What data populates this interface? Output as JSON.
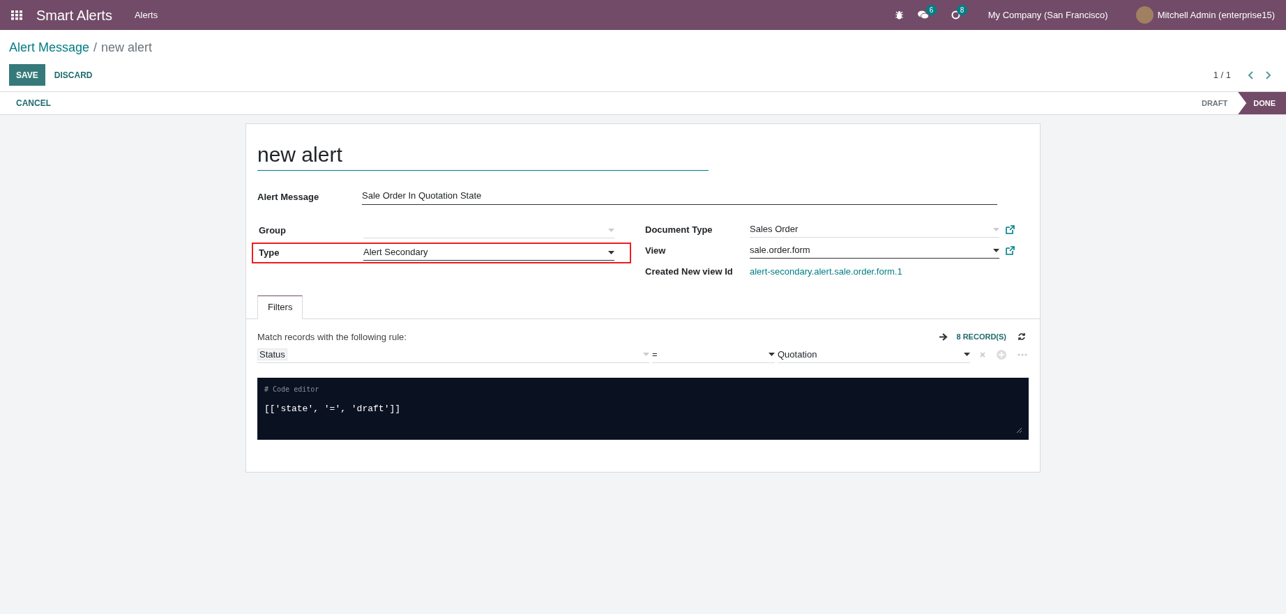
{
  "navbar": {
    "app_name": "Smart Alerts",
    "menu": [
      "Alerts"
    ],
    "messages_count": "6",
    "activities_count": "8",
    "company": "My Company (San Francisco)",
    "user": "Mitchell Admin (enterprise15)"
  },
  "breadcrumb": {
    "parent": "Alert Message",
    "separator": "/",
    "current": "new alert"
  },
  "actions": [
    {
      "label": "SAVE",
      "kind": "primary"
    },
    {
      "label": "DISCARD",
      "kind": "link"
    }
  ],
  "pager": "1 / 1",
  "header_buttons": [
    "CANCEL"
  ],
  "stages": [
    {
      "label": "DRAFT",
      "selected": false
    },
    {
      "label": "DONE",
      "selected": true
    }
  ],
  "form": {
    "title": "new alert",
    "alert_message": {
      "label": "Alert Message",
      "value": "Sale Order In Quotation State"
    },
    "left_fields": [
      {
        "label": "Group",
        "kind": "select",
        "strong": false,
        "highlighted": false
      },
      {
        "label": "Type",
        "kind": "select",
        "value": "Alert Secondary",
        "strong": true,
        "highlighted": true
      }
    ],
    "right_fields": [
      {
        "label": "Document Type",
        "kind": "select",
        "value": "Sales Order",
        "strong": false,
        "external_link": true
      },
      {
        "label": "View",
        "kind": "select",
        "value": "sale.order.form",
        "strong": true,
        "external_link": true
      },
      {
        "label": "Created New view Id",
        "kind": "link",
        "value": "alert-secondary.alert.sale.order.form.1",
        "external_link": false
      }
    ]
  },
  "tabs": [
    {
      "label": "Filters",
      "selected": true
    }
  ],
  "filters": {
    "intro": "Match records with the following rule:",
    "records": "8 RECORD(S)",
    "rule": {
      "field": "Status",
      "operator": "=",
      "value": "Quotation"
    },
    "code_comment": "# Code editor",
    "code": "[['state', '=', 'draft']]"
  }
}
